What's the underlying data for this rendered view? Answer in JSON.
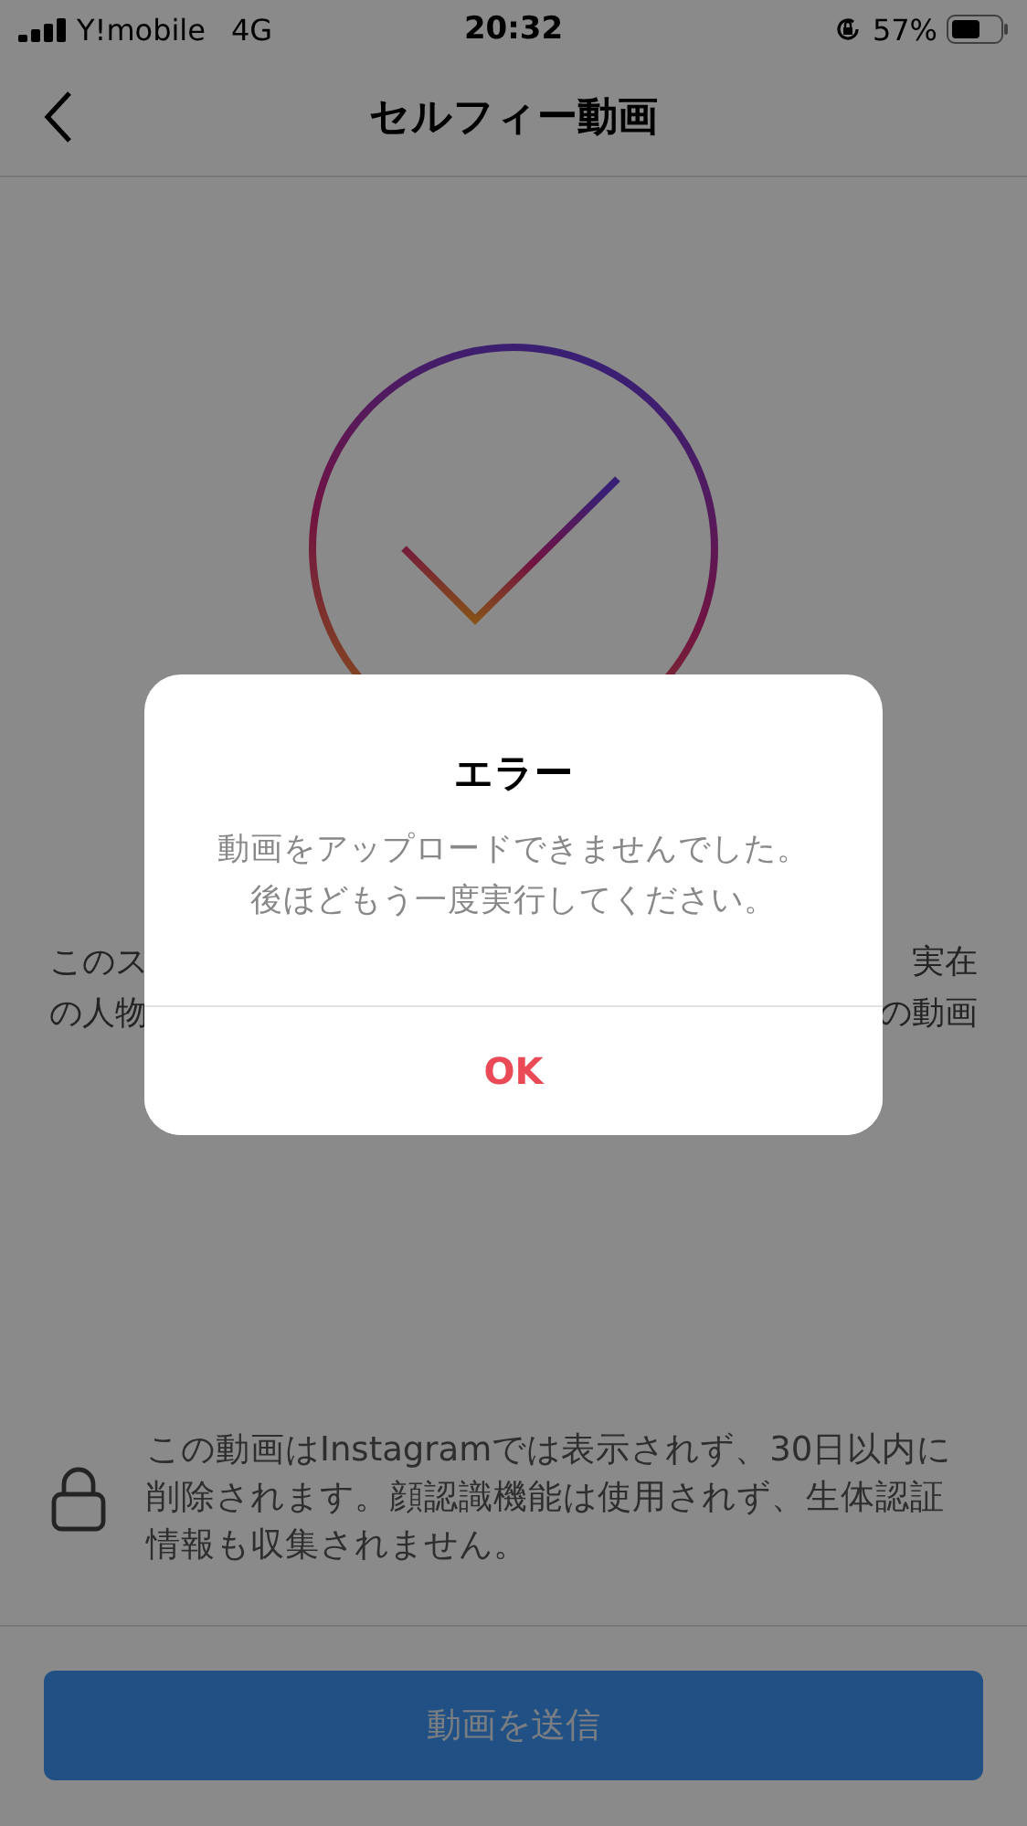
{
  "status_bar": {
    "carrier": "Y!mobile",
    "network": "4G",
    "time": "20:32",
    "battery": "57%"
  },
  "nav": {
    "title": "セルフィー動画"
  },
  "intro_fragments": {
    "left": [
      "このス",
      "の人物"
    ],
    "right": [
      "実在",
      "の動画"
    ]
  },
  "privacy_note": "この動画はInstagramでは表示されず、30日以内に削除されます。顔認識機能は使用されず、生体認証情報も収集されません。",
  "submit_button": {
    "label": "動画を送信"
  },
  "dialog": {
    "title": "エラー",
    "message": [
      "動画をアップロードできませんでした。",
      "後ほどもう一度実行してください。"
    ],
    "buttons": [
      "OK"
    ]
  }
}
